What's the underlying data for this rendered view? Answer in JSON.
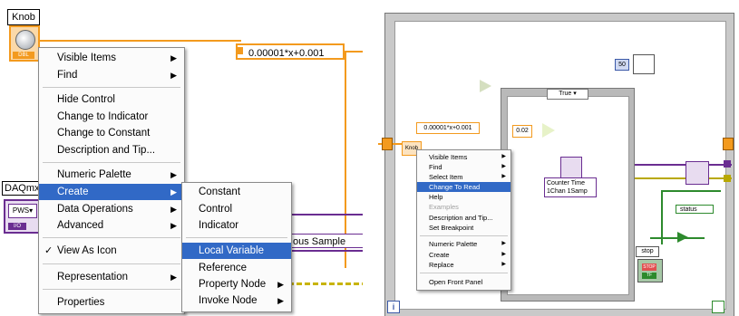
{
  "left": {
    "knob_label": "Knob",
    "knob_type": "DBL",
    "formula": "0.00001*x+0.001",
    "daq_label": "DAQmx",
    "daq_inner": "PWS",
    "daq_io": "I/O",
    "bg_text": "ous Sample",
    "context_menu": {
      "items": [
        {
          "label": "Visible Items",
          "submenu": true
        },
        {
          "label": "Find",
          "submenu": true
        },
        {
          "label": "Hide Control"
        },
        {
          "label": "Change to Indicator"
        },
        {
          "label": "Change to Constant"
        },
        {
          "label": "Description and Tip..."
        },
        {
          "label": "Numeric Palette",
          "submenu": true
        },
        {
          "label": "Create",
          "submenu": true,
          "highlighted": true
        },
        {
          "label": "Data Operations",
          "submenu": true
        },
        {
          "label": "Advanced",
          "submenu": true
        },
        {
          "label": "View As Icon",
          "checked": true
        },
        {
          "label": "Representation",
          "submenu": true
        },
        {
          "label": "Properties"
        }
      ]
    },
    "create_submenu": {
      "items": [
        {
          "label": "Constant"
        },
        {
          "label": "Control"
        },
        {
          "label": "Indicator"
        },
        {
          "label": "Local Variable",
          "highlighted": true
        },
        {
          "label": "Reference"
        },
        {
          "label": "Property Node",
          "submenu": true
        },
        {
          "label": "Invoke Node",
          "submenu": true
        }
      ]
    }
  },
  "right": {
    "case_selector": "True",
    "formula": "0.00001*x+0.001",
    "knob": "Knob",
    "const_002": "0.02",
    "num_50": "50",
    "counter_line1": "Counter Time",
    "counter_line2": "1Chan 1Samp",
    "status": "status",
    "stop_label": "stop",
    "stop_btn": "STOP",
    "stop_sub": "TF",
    "info": "i",
    "context_menu": {
      "items": [
        {
          "label": "Visible Items",
          "submenu": true
        },
        {
          "label": "Find",
          "submenu": true
        },
        {
          "label": "Select Item",
          "submenu": true
        },
        {
          "label": "Change To Read",
          "highlighted": true
        },
        {
          "label": "Help"
        },
        {
          "label": "Examples",
          "disabled": true
        },
        {
          "label": "Description and Tip..."
        },
        {
          "label": "Set Breakpoint"
        },
        {
          "label": "Numeric Palette",
          "submenu": true
        },
        {
          "label": "Create",
          "submenu": true
        },
        {
          "label": "Replace",
          "submenu": true
        },
        {
          "label": "Open Front Panel"
        }
      ]
    }
  },
  "icons": {
    "submenu_arrow": "▶",
    "check": "✓",
    "dropdown": "▾"
  }
}
